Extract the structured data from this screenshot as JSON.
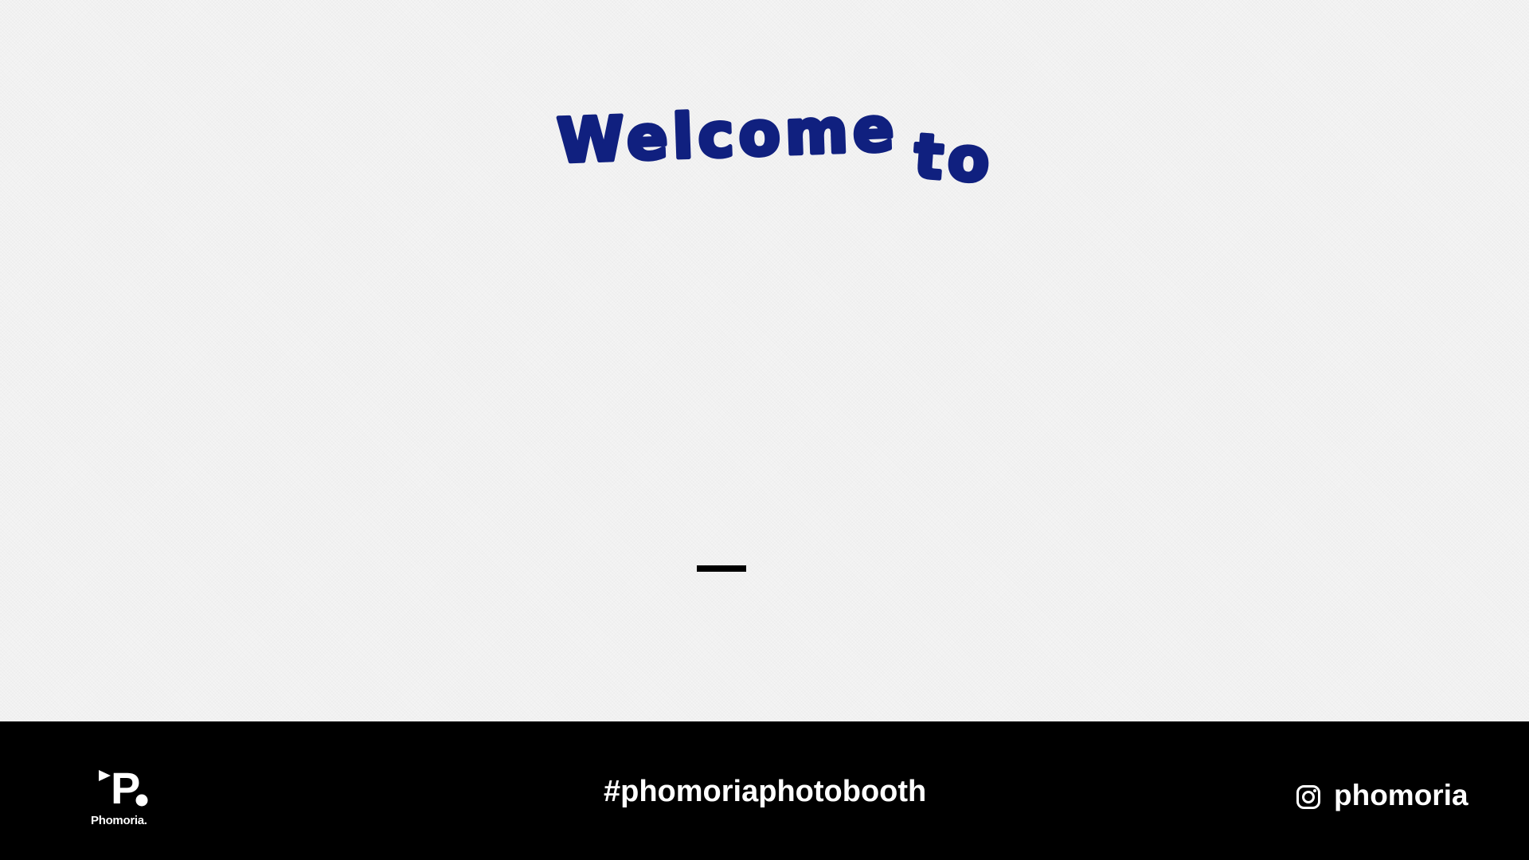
{
  "main": {
    "welcome_words": [
      "Welcome",
      "to"
    ]
  },
  "footer": {
    "brand": {
      "logo_letter": "P",
      "name": "Phomoria."
    },
    "hashtag": "#phomoriaphotobooth",
    "social": {
      "icon": "instagram-icon",
      "handle": "phomoria"
    }
  },
  "colors": {
    "background": "#f4f4f4",
    "welcome_text": "#10207f",
    "footer_background": "#000000",
    "footer_text": "#ffffff"
  }
}
